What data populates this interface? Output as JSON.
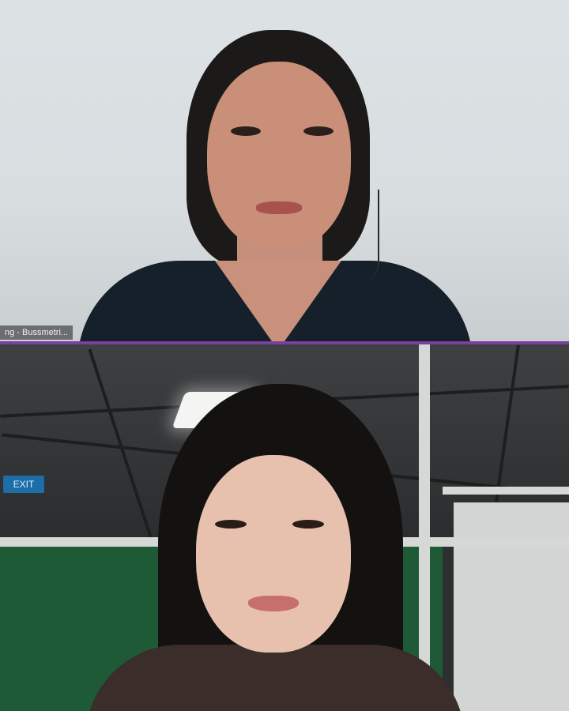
{
  "meeting": {
    "participants": [
      {
        "id": "participant-1",
        "name_label": "ng - Bussmetri...",
        "active_speaker": false
      },
      {
        "id": "participant-2",
        "name_label": "",
        "active_speaker": true
      }
    ],
    "room": {
      "exit_sign": "EXIT"
    },
    "colors": {
      "active_speaker_border": "#7b3fa0",
      "tile_background_top": "#dde2e5",
      "tile_background_bottom": "#2d2f31"
    }
  }
}
